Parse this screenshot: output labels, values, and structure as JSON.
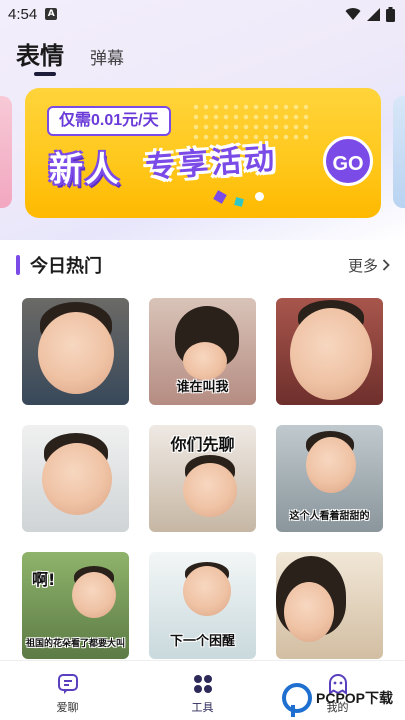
{
  "status_bar": {
    "time": "4:54",
    "app_icon": "A",
    "wifi_icon": "wifi-icon",
    "signal_icon": "signal-icon",
    "battery_icon": "battery-icon"
  },
  "tabs": [
    {
      "label": "表情",
      "active": true
    },
    {
      "label": "弹幕",
      "active": false
    }
  ],
  "banner": {
    "price": "仅需0.01元/天",
    "headline_1": "新人",
    "headline_2": "专享活动",
    "go": "GO"
  },
  "section": {
    "title": "今日热门",
    "more": "更多",
    "more_icon": "chevron-right-icon"
  },
  "stickers": [
    {
      "caption": ""
    },
    {
      "caption": "谁在叫我"
    },
    {
      "caption": ""
    },
    {
      "caption": ""
    },
    {
      "caption_top": "你们先聊"
    },
    {
      "caption": "这个人看着甜甜的"
    },
    {
      "caption_top": "啊!",
      "caption": "祖国的花朵看了都要大叫"
    },
    {
      "caption": "下一个困醒"
    },
    {
      "caption": ""
    }
  ],
  "bottom_nav": [
    {
      "label": "爱聊",
      "icon": "chat-icon"
    },
    {
      "label": "工具",
      "icon": "grid-dots-icon",
      "active": true
    },
    {
      "label": "我的",
      "icon": "ghost-icon"
    }
  ],
  "watermark": "PCPOP下载",
  "colors": {
    "accent": "#7b4be8",
    "banner": "#ffc71a",
    "nav_active": "#2d2a5a"
  }
}
